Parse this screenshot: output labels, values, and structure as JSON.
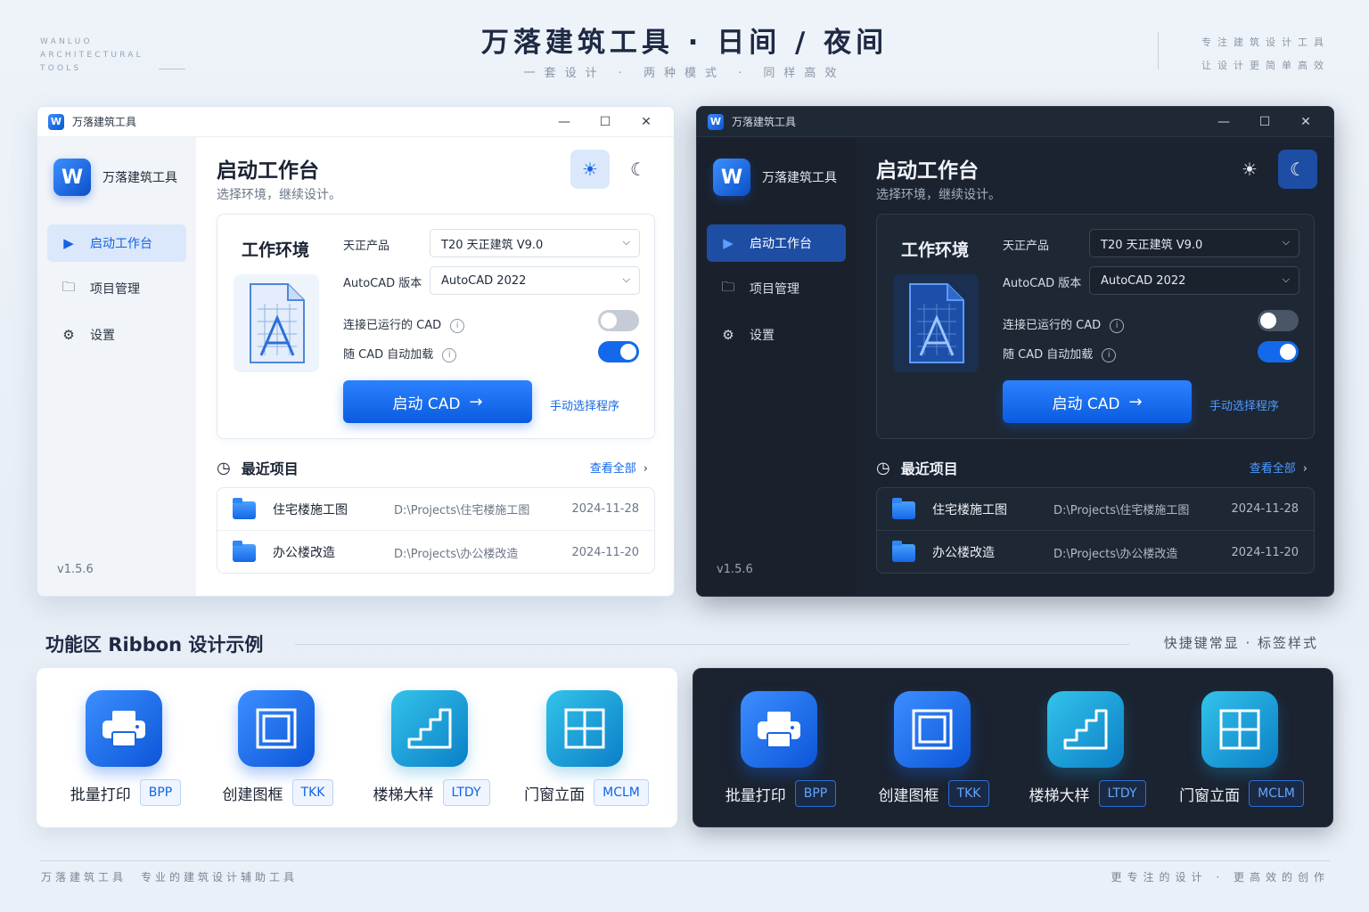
{
  "header": {
    "brand_en": "WANLUO ARCHITECTURAL TOOLS",
    "title": "万落建筑工具 · 日间 / 夜间",
    "subtitle": "一套设计 · 两种模式 · 同样高效",
    "tagline_1": "专注建筑设计工具",
    "tagline_2": "让设计更简单高效"
  },
  "window": {
    "logo_letter": "W",
    "title": "万落建筑工具",
    "controls": {
      "minimize": "—",
      "maximize": "☐",
      "close": "✕"
    },
    "sidebar": {
      "app_name": "万落建筑工具",
      "items": [
        {
          "label": "启动工作台",
          "icon": "play-icon"
        },
        {
          "label": "项目管理",
          "icon": "folder-icon"
        },
        {
          "label": "设置",
          "icon": "gear-icon"
        }
      ],
      "version": "v1.5.6"
    },
    "page_title": "启动工作台",
    "page_subtitle": "选择环境，继续设计。",
    "theme": {
      "sun_icon": "sun-icon",
      "moon_icon": "moon-icon"
    },
    "env": {
      "title": "工作环境",
      "product_label": "天正产品",
      "product_value": "T20 天正建筑 V9.0",
      "autocad_label": "AutoCAD 版本",
      "autocad_value": "AutoCAD 2022",
      "connect_label": "连接已运行的 CAD",
      "connect_on": false,
      "autoload_label": "随 CAD 自动加载",
      "autoload_on": true,
      "launch_label": "启动 CAD",
      "manual_link": "手动选择程序"
    },
    "recent": {
      "title": "最近项目",
      "view_all": "查看全部",
      "items": [
        {
          "name": "住宅楼施工图",
          "path": "D:\\Projects\\住宅楼施工图",
          "date": "2024-11-28"
        },
        {
          "name": "办公楼改造",
          "path": "D:\\Projects\\办公楼改造",
          "date": "2024-11-20"
        }
      ]
    }
  },
  "ribbon": {
    "title": "功能区 Ribbon 设计示例",
    "note": "快捷键常显 · 标签样式",
    "tools": [
      {
        "name": "批量打印",
        "code": "BPP",
        "icon": "printer-icon"
      },
      {
        "name": "创建图框",
        "code": "TKK",
        "icon": "frame-icon"
      },
      {
        "name": "楼梯大样",
        "code": "LTDY",
        "icon": "stairs-icon"
      },
      {
        "name": "门窗立面",
        "code": "MCLM",
        "icon": "window-icon"
      }
    ]
  },
  "footer": {
    "left": "万落建筑工具　专业的建筑设计辅助工具",
    "right": "更专注的设计 · 更高效的创作"
  },
  "colors": {
    "accent": "#1469ea",
    "light_bg": "#ffffff",
    "dark_bg": "#1b2330",
    "page_bg": "#eef3f9"
  }
}
